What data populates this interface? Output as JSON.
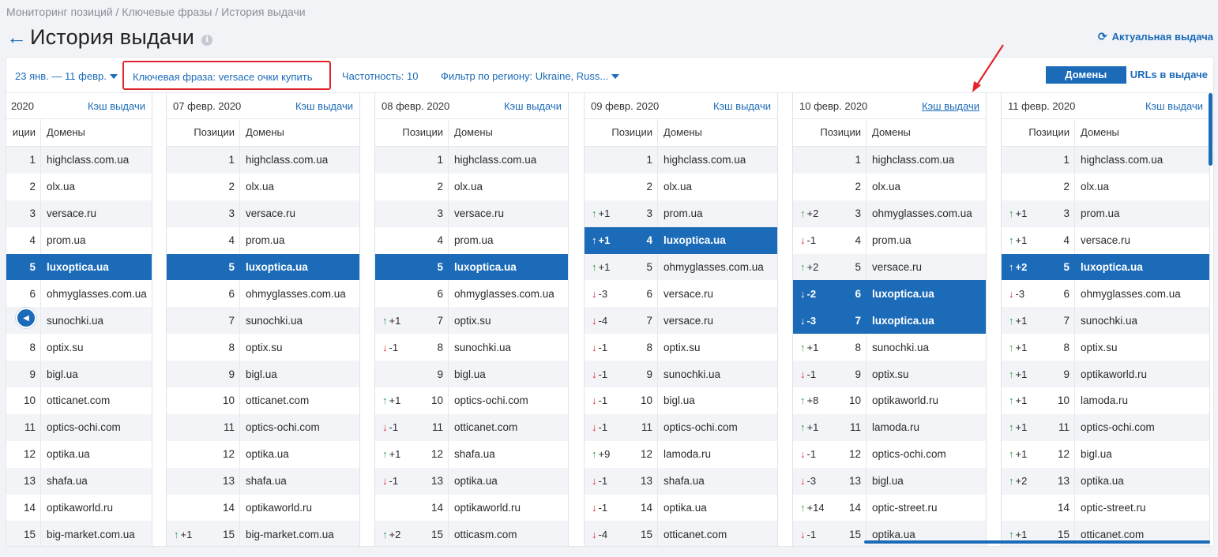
{
  "breadcrumb": "Мониторинг позиций / Ключевые фразы / История выдачи",
  "page": {
    "title": "История выдачи",
    "info_icon": "i",
    "actual_link": "Актуальная выдача"
  },
  "filters": {
    "date_range": "23 янв. — 11 февр.",
    "keyword": "Ключевая фраза: versace очки купить",
    "frequency": "Частотность: 10",
    "region": "Фильтр по региону: Ukraine, Russ..."
  },
  "view_toggle": {
    "domains": "Домены",
    "urls": "URLs в выдаче"
  },
  "table_headers": {
    "positions": "Позиции",
    "positions_cut": "иции",
    "domains": "Домены"
  },
  "colors": {
    "accent": "#1c6bb8",
    "up": "#2f9e44",
    "down": "#e0262b",
    "annotation": "#e0262b"
  },
  "days": [
    {
      "date": "2020",
      "cache": "Кэш выдачи",
      "rows": [
        {
          "pos": "1",
          "domain": "highclass.com.ua",
          "dir": "",
          "delta": ""
        },
        {
          "pos": "2",
          "domain": "olx.ua",
          "dir": "",
          "delta": ""
        },
        {
          "pos": "3",
          "domain": "versace.ru",
          "dir": "",
          "delta": ""
        },
        {
          "pos": "4",
          "domain": "prom.ua",
          "dir": "",
          "delta": ""
        },
        {
          "pos": "5",
          "domain": "luxoptica.ua",
          "dir": "",
          "delta": "",
          "hl": true
        },
        {
          "pos": "6",
          "domain": "ohmyglasses.com.ua",
          "dir": "",
          "delta": ""
        },
        {
          "pos": "7",
          "domain": "sunochki.ua",
          "dir": "",
          "delta": ""
        },
        {
          "pos": "8",
          "domain": "optix.su",
          "dir": "",
          "delta": ""
        },
        {
          "pos": "9",
          "domain": "bigl.ua",
          "dir": "",
          "delta": ""
        },
        {
          "pos": "10",
          "domain": "otticanet.com",
          "dir": "",
          "delta": ""
        },
        {
          "pos": "11",
          "domain": "optics-ochi.com",
          "dir": "",
          "delta": ""
        },
        {
          "pos": "12",
          "domain": "optika.ua",
          "dir": "",
          "delta": ""
        },
        {
          "pos": "13",
          "domain": "shafa.ua",
          "dir": "",
          "delta": ""
        },
        {
          "pos": "14",
          "domain": "optikaworld.ru",
          "dir": "",
          "delta": ""
        },
        {
          "pos": "15",
          "domain": "big-market.com.ua",
          "dir": "",
          "delta": ""
        }
      ]
    },
    {
      "date": "07 февр. 2020",
      "cache": "Кэш выдачи",
      "rows": [
        {
          "pos": "1",
          "domain": "highclass.com.ua",
          "dir": "",
          "delta": ""
        },
        {
          "pos": "2",
          "domain": "olx.ua",
          "dir": "",
          "delta": ""
        },
        {
          "pos": "3",
          "domain": "versace.ru",
          "dir": "",
          "delta": ""
        },
        {
          "pos": "4",
          "domain": "prom.ua",
          "dir": "",
          "delta": ""
        },
        {
          "pos": "5",
          "domain": "luxoptica.ua",
          "dir": "",
          "delta": "",
          "hl": true
        },
        {
          "pos": "6",
          "domain": "ohmyglasses.com.ua",
          "dir": "",
          "delta": ""
        },
        {
          "pos": "7",
          "domain": "sunochki.ua",
          "dir": "",
          "delta": ""
        },
        {
          "pos": "8",
          "domain": "optix.su",
          "dir": "",
          "delta": ""
        },
        {
          "pos": "9",
          "domain": "bigl.ua",
          "dir": "",
          "delta": ""
        },
        {
          "pos": "10",
          "domain": "otticanet.com",
          "dir": "",
          "delta": ""
        },
        {
          "pos": "11",
          "domain": "optics-ochi.com",
          "dir": "",
          "delta": ""
        },
        {
          "pos": "12",
          "domain": "optika.ua",
          "dir": "",
          "delta": ""
        },
        {
          "pos": "13",
          "domain": "shafa.ua",
          "dir": "",
          "delta": ""
        },
        {
          "pos": "14",
          "domain": "optikaworld.ru",
          "dir": "",
          "delta": ""
        },
        {
          "pos": "15",
          "domain": "big-market.com.ua",
          "dir": "up",
          "delta": "+1"
        }
      ]
    },
    {
      "date": "08 февр. 2020",
      "cache": "Кэш выдачи",
      "rows": [
        {
          "pos": "1",
          "domain": "highclass.com.ua",
          "dir": "",
          "delta": ""
        },
        {
          "pos": "2",
          "domain": "olx.ua",
          "dir": "",
          "delta": ""
        },
        {
          "pos": "3",
          "domain": "versace.ru",
          "dir": "",
          "delta": ""
        },
        {
          "pos": "4",
          "domain": "prom.ua",
          "dir": "",
          "delta": ""
        },
        {
          "pos": "5",
          "domain": "luxoptica.ua",
          "dir": "",
          "delta": "",
          "hl": true
        },
        {
          "pos": "6",
          "domain": "ohmyglasses.com.ua",
          "dir": "",
          "delta": ""
        },
        {
          "pos": "7",
          "domain": "optix.su",
          "dir": "up",
          "delta": "+1"
        },
        {
          "pos": "8",
          "domain": "sunochki.ua",
          "dir": "down",
          "delta": "-1"
        },
        {
          "pos": "9",
          "domain": "bigl.ua",
          "dir": "",
          "delta": ""
        },
        {
          "pos": "10",
          "domain": "optics-ochi.com",
          "dir": "up",
          "delta": "+1"
        },
        {
          "pos": "11",
          "domain": "otticanet.com",
          "dir": "down",
          "delta": "-1"
        },
        {
          "pos": "12",
          "domain": "shafa.ua",
          "dir": "up",
          "delta": "+1"
        },
        {
          "pos": "13",
          "domain": "optika.ua",
          "dir": "down",
          "delta": "-1"
        },
        {
          "pos": "14",
          "domain": "optikaworld.ru",
          "dir": "",
          "delta": ""
        },
        {
          "pos": "15",
          "domain": "otticasm.com",
          "dir": "up",
          "delta": "+2"
        }
      ]
    },
    {
      "date": "09 февр. 2020",
      "cache": "Кэш выдачи",
      "rows": [
        {
          "pos": "1",
          "domain": "highclass.com.ua",
          "dir": "",
          "delta": ""
        },
        {
          "pos": "2",
          "domain": "olx.ua",
          "dir": "",
          "delta": ""
        },
        {
          "pos": "3",
          "domain": "prom.ua",
          "dir": "up",
          "delta": "+1"
        },
        {
          "pos": "4",
          "domain": "luxoptica.ua",
          "dir": "up",
          "delta": "+1",
          "hl": true
        },
        {
          "pos": "5",
          "domain": "ohmyglasses.com.ua",
          "dir": "up",
          "delta": "+1"
        },
        {
          "pos": "6",
          "domain": "versace.ru",
          "dir": "down",
          "delta": "-3"
        },
        {
          "pos": "7",
          "domain": "versace.ru",
          "dir": "down",
          "delta": "-4"
        },
        {
          "pos": "8",
          "domain": "optix.su",
          "dir": "down",
          "delta": "-1"
        },
        {
          "pos": "9",
          "domain": "sunochki.ua",
          "dir": "down",
          "delta": "-1"
        },
        {
          "pos": "10",
          "domain": "bigl.ua",
          "dir": "down",
          "delta": "-1"
        },
        {
          "pos": "11",
          "domain": "optics-ochi.com",
          "dir": "down",
          "delta": "-1"
        },
        {
          "pos": "12",
          "domain": "lamoda.ru",
          "dir": "up",
          "delta": "+9"
        },
        {
          "pos": "13",
          "domain": "shafa.ua",
          "dir": "down",
          "delta": "-1"
        },
        {
          "pos": "14",
          "domain": "optika.ua",
          "dir": "down",
          "delta": "-1"
        },
        {
          "pos": "15",
          "domain": "otticanet.com",
          "dir": "down",
          "delta": "-4"
        }
      ]
    },
    {
      "date": "10 февр. 2020",
      "cache": "Кэш выдачи",
      "cache_underlined": true,
      "rows": [
        {
          "pos": "1",
          "domain": "highclass.com.ua",
          "dir": "",
          "delta": ""
        },
        {
          "pos": "2",
          "domain": "olx.ua",
          "dir": "",
          "delta": ""
        },
        {
          "pos": "3",
          "domain": "ohmyglasses.com.ua",
          "dir": "up",
          "delta": "+2"
        },
        {
          "pos": "4",
          "domain": "prom.ua",
          "dir": "down",
          "delta": "-1"
        },
        {
          "pos": "5",
          "domain": "versace.ru",
          "dir": "up",
          "delta": "+2"
        },
        {
          "pos": "6",
          "domain": "luxoptica.ua",
          "dir": "down",
          "delta": "-2",
          "hl": true
        },
        {
          "pos": "7",
          "domain": "luxoptica.ua",
          "dir": "down",
          "delta": "-3",
          "hl": true
        },
        {
          "pos": "8",
          "domain": "sunochki.ua",
          "dir": "up",
          "delta": "+1"
        },
        {
          "pos": "9",
          "domain": "optix.su",
          "dir": "down",
          "delta": "-1"
        },
        {
          "pos": "10",
          "domain": "optikaworld.ru",
          "dir": "up",
          "delta": "+8"
        },
        {
          "pos": "11",
          "domain": "lamoda.ru",
          "dir": "up",
          "delta": "+1"
        },
        {
          "pos": "12",
          "domain": "optics-ochi.com",
          "dir": "down",
          "delta": "-1"
        },
        {
          "pos": "13",
          "domain": "bigl.ua",
          "dir": "down",
          "delta": "-3"
        },
        {
          "pos": "14",
          "domain": "optic-street.ru",
          "dir": "up",
          "delta": "+14"
        },
        {
          "pos": "15",
          "domain": "optika.ua",
          "dir": "down",
          "delta": "-1"
        }
      ]
    },
    {
      "date": "11 февр. 2020",
      "cache": "Кэш выдачи",
      "rows": [
        {
          "pos": "1",
          "domain": "highclass.com.ua",
          "dir": "",
          "delta": ""
        },
        {
          "pos": "2",
          "domain": "olx.ua",
          "dir": "",
          "delta": ""
        },
        {
          "pos": "3",
          "domain": "prom.ua",
          "dir": "up",
          "delta": "+1"
        },
        {
          "pos": "4",
          "domain": "versace.ru",
          "dir": "up",
          "delta": "+1"
        },
        {
          "pos": "5",
          "domain": "luxoptica.ua",
          "dir": "up",
          "delta": "+2",
          "hl": true
        },
        {
          "pos": "6",
          "domain": "ohmyglasses.com.ua",
          "dir": "down",
          "delta": "-3"
        },
        {
          "pos": "7",
          "domain": "sunochki.ua",
          "dir": "up",
          "delta": "+1"
        },
        {
          "pos": "8",
          "domain": "optix.su",
          "dir": "up",
          "delta": "+1"
        },
        {
          "pos": "9",
          "domain": "optikaworld.ru",
          "dir": "up",
          "delta": "+1"
        },
        {
          "pos": "10",
          "domain": "lamoda.ru",
          "dir": "up",
          "delta": "+1"
        },
        {
          "pos": "11",
          "domain": "optics-ochi.com",
          "dir": "up",
          "delta": "+1"
        },
        {
          "pos": "12",
          "domain": "bigl.ua",
          "dir": "up",
          "delta": "+1"
        },
        {
          "pos": "13",
          "domain": "optika.ua",
          "dir": "up",
          "delta": "+2"
        },
        {
          "pos": "14",
          "domain": "optic-street.ru",
          "dir": "",
          "delta": ""
        },
        {
          "pos": "15",
          "domain": "otticanet.com",
          "dir": "up",
          "delta": "+1"
        }
      ]
    }
  ]
}
